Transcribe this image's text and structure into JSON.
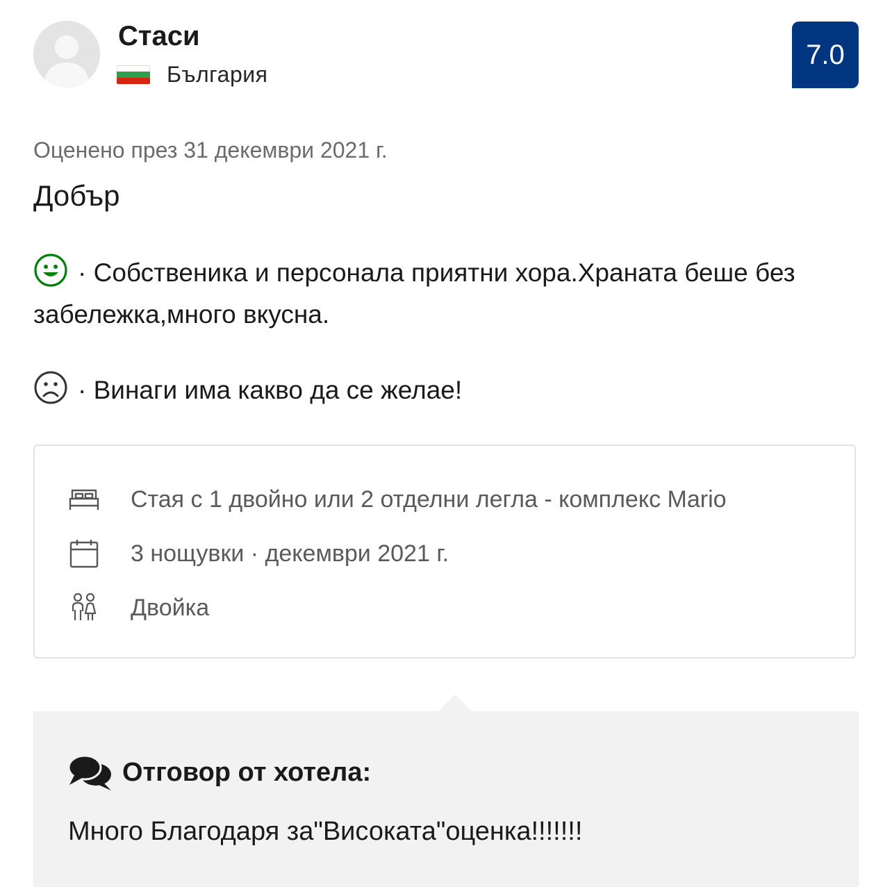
{
  "reviewer": {
    "name": "Стаси",
    "country": "България",
    "flag_colors": [
      "#ffffff",
      "#2e9e4f",
      "#d62612"
    ]
  },
  "score": "7.0",
  "review": {
    "date": "Оценено през 31 декември 2021 г.",
    "title": "Добър",
    "positive_icon": "smile-icon",
    "positive": "· Собственика и персонала приятни хора.Храната беше без забележка,много вкусна.",
    "negative_icon": "frown-icon",
    "negative": "· Винаги има какво да се желае!"
  },
  "stay": {
    "room_icon": "bed-icon",
    "room": "Стая с 1 двойно или 2 отделни легла - комплекс Mario",
    "nights_icon": "calendar-icon",
    "nights": "3 нощувки · декември 2021 г.",
    "traveler_icon": "couple-icon",
    "traveler_type": "Двойка"
  },
  "hotel_reply": {
    "icon": "speech-bubbles-icon",
    "heading": "Отговор от хотела:",
    "text": "Много Благодаря за\"Високата\"оценка!!!!!!!"
  },
  "colors": {
    "score_bg": "#003580",
    "positive_icon": "#008009",
    "reply_bg": "#f2f2f2"
  }
}
